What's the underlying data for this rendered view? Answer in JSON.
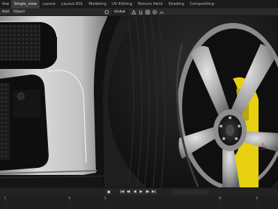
{
  "topbar": {
    "menu_partial": "line",
    "tabs": [
      {
        "label": "Single_view",
        "active": true
      },
      {
        "label": "Layout",
        "active": false
      },
      {
        "label": "Layout.001",
        "active": false
      },
      {
        "label": "Modeling",
        "active": false
      },
      {
        "label": "UV Editing",
        "active": false
      },
      {
        "label": "Texture Paint",
        "active": false
      },
      {
        "label": "Shading",
        "active": false
      },
      {
        "label": "Compositing",
        "active": false
      }
    ]
  },
  "viewport_header": {
    "add_label": "Add",
    "object_label": "Object",
    "transform_orientation": "Global"
  },
  "timeline": {
    "frames": [
      "1",
      "4",
      "5",
      "8",
      "9"
    ]
  },
  "colors": {
    "active_tab": "#3b3b3b",
    "caliper": "#e6d010",
    "body_paint": "#c9c9c9"
  }
}
